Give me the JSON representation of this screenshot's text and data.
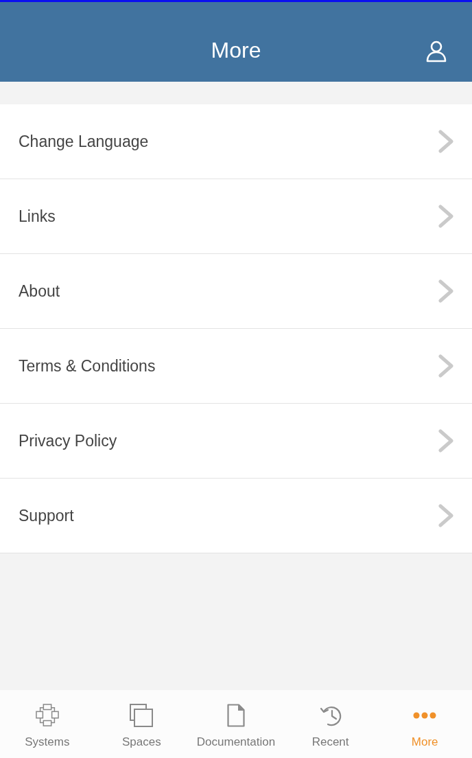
{
  "header": {
    "title": "More"
  },
  "menu_items": [
    {
      "label": "Change Language"
    },
    {
      "label": "Links"
    },
    {
      "label": "About"
    },
    {
      "label": "Terms & Conditions"
    },
    {
      "label": "Privacy Policy"
    },
    {
      "label": "Support"
    }
  ],
  "tab_bar": {
    "tabs": [
      {
        "kind": "systems",
        "label": "Systems",
        "selected": false
      },
      {
        "kind": "spaces",
        "label": "Spaces",
        "selected": false
      },
      {
        "kind": "documentation",
        "label": "Documentation",
        "selected": false
      },
      {
        "kind": "recent",
        "label": "Recent",
        "selected": false
      },
      {
        "kind": "more",
        "label": "More",
        "selected": true
      }
    ]
  }
}
